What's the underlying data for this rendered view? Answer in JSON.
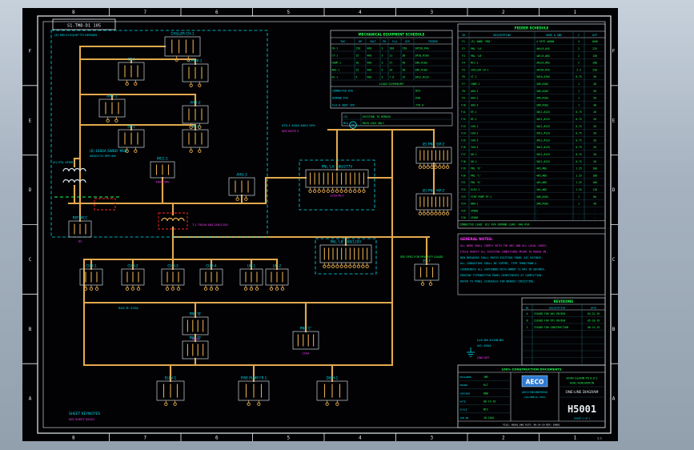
{
  "window": {
    "title_box": "S1-TM8-D1 105"
  },
  "frame": {
    "zone_cols": [
      "8",
      "7",
      "6",
      "5",
      "4",
      "3",
      "2",
      "1"
    ],
    "zone_rows": [
      "F",
      "E",
      "D",
      "C",
      "B",
      "A"
    ],
    "stamp": "1:1"
  },
  "colors": {
    "bus": "#e2a94f",
    "label": "#00dcf0",
    "magenta": "#ff3dff",
    "green": "#23ff55",
    "red": "#ff2424",
    "white": "#e9eef2",
    "logo": "#2e79cf",
    "grid": "#c9d5dc",
    "dimline": "#2a4f56"
  },
  "components": [
    {
      "id": "chiller-ch1",
      "label": "CHILLER CH-1",
      "sub": ""
    },
    {
      "id": "ct1",
      "label": "CT-1",
      "sub": ""
    },
    {
      "id": "chwp1",
      "label": "CHWP-1",
      "sub": ""
    },
    {
      "id": "ahu1",
      "label": "AHU-1",
      "sub": ""
    },
    {
      "id": "ahu2",
      "label": "AHU-2",
      "sub": ""
    },
    {
      "id": "ef1",
      "label": "EF-1",
      "sub": ""
    },
    {
      "id": "rf1",
      "label": "RF-1",
      "sub": ""
    },
    {
      "id": "mcc1",
      "label": "MCC-1",
      "sub": "480V 3PH"
    },
    {
      "id": "ahu3",
      "label": "AHU-3",
      "sub": ""
    },
    {
      "id": "ref-mcc",
      "label": "REF MCC",
      "sub": "(E)"
    },
    {
      "id": "pnl-la",
      "label": "PNL 'LA' 480/277V",
      "sub": "225A MLO"
    },
    {
      "id": "pnl-lb",
      "label": "PNL 'LB' 208/120V",
      "sub": ""
    },
    {
      "id": "dp1",
      "label": "(E) PNL 'DP-1'",
      "sub": ""
    },
    {
      "id": "hp1",
      "label": "(E) PNL 'HP-1'",
      "sub": ""
    },
    {
      "id": "cuh1",
      "label": "CUH-1",
      "sub": ""
    },
    {
      "id": "cuh2",
      "label": "CUH-2",
      "sub": ""
    },
    {
      "id": "cuh3",
      "label": "CUH-3",
      "sub": ""
    },
    {
      "id": "cuh4",
      "label": "CUH-4",
      "sub": ""
    },
    {
      "id": "uh1",
      "label": "UH-1",
      "sub": ""
    },
    {
      "id": "uh2",
      "label": "UH-2",
      "sub": ""
    },
    {
      "id": "ef7",
      "label": "EF-7",
      "sub": ""
    },
    {
      "id": "pnl-b",
      "label": "PNL 'B'",
      "sub": "100A"
    },
    {
      "id": "pnl-c",
      "label": "PNL 'C'",
      "sub": "100A"
    },
    {
      "id": "pnl-d",
      "label": "PNL 'D'",
      "sub": ""
    },
    {
      "id": "elev1",
      "label": "ELEV-1",
      "sub": ""
    },
    {
      "id": "fp1",
      "label": "FIRE PUMP FP-1",
      "sub": ""
    },
    {
      "id": "dwh1",
      "label": "DWH-1",
      "sub": ""
    }
  ],
  "texts": [
    "(E) MECH EQUIP TO REMAIN",
    "(E) 1600A SWBD 'MSB'",
    "480/277V 3PH 4W",
    "ATS-1 400A 480V 3PH",
    "SEE NOTE 5",
    "SEE SPEC FOR PRIORITY LOADS",
    "LUG BK 40-BB-BD",
    "AIC: 65KA",
    "GND DET",
    "SHEET KEYNOTES",
    "SEE SHEET E0001",
    "BUS 'B' 225A",
    "T-1 75KVA 480-208/120V",
    "M",
    "(E) UTIL XFMR"
  ],
  "equipment_schedule": {
    "title": "MECHANICAL EQUIPMENT SCHEDULE",
    "headers": [
      "TAG",
      "HP",
      "VOLT",
      "PH",
      "FLA",
      "OCP",
      "FEEDER"
    ],
    "rows": [
      [
        "CH-1",
        "150",
        "460",
        "3",
        "180",
        "250",
        "3#250,#4G"
      ],
      [
        "CT-1",
        "15",
        "460",
        "3",
        "21",
        "30",
        "3#10,#10G"
      ],
      [
        "CHWP-1",
        "20",
        "460",
        "3",
        "27",
        "40",
        "3#8,#10G"
      ],
      [
        "AHU-1",
        "25",
        "460",
        "3",
        "34",
        "50",
        "3#6,#10G"
      ],
      [
        "EF-1",
        "5",
        "460",
        "3",
        "7.6",
        "15",
        "3#12,#12G"
      ]
    ],
    "summary_title": "LOAD SUMMARY",
    "summary": [
      [
        "CONNECTED KVA",
        "825"
      ],
      [
        "DEMAND KVA",
        "640"
      ],
      [
        "FLA @ 480V 3PH",
        "770 A"
      ]
    ]
  },
  "abbreviations": [
    [
      "(E)",
      "EXISTING TO REMAIN"
    ],
    [
      "MLO",
      "MAIN LUGS ONLY"
    ]
  ],
  "feeder_schedule": {
    "title": "FEEDER SCHEDULE",
    "headers": [
      "ID",
      "DESCRIPTION",
      "WIRE & GND",
      "C",
      "OCP"
    ],
    "rows": [
      [
        "F1",
        "(E) SWBD 'MSB'",
        "4 SETS 4#600",
        "4",
        "1600"
      ],
      [
        "F2",
        "PNL 'LA'",
        "4#4/0,#4G",
        "2",
        "225"
      ],
      [
        "F3",
        "PNL 'LB'",
        "4#1/0,#6G",
        "2",
        "150"
      ],
      [
        "F4",
        "MCC-1",
        "3#3/0,#6G",
        "2",
        "200"
      ],
      [
        "F5",
        "CHILLER CH-1",
        "3#250,#4G",
        "2.5",
        "250"
      ],
      [
        "F6",
        "CT-1",
        "3#10,#10G",
        "0.75",
        "30"
      ],
      [
        "F7",
        "CHWP-1",
        "3#8,#10G",
        "1",
        "40"
      ],
      [
        "F8",
        "AHU-1",
        "3#6,#10G",
        "1",
        "50"
      ],
      [
        "F9",
        "AHU-2",
        "3#6,#10G",
        "1",
        "50"
      ],
      [
        "F10",
        "AHU-3",
        "3#8,#10G",
        "1",
        "40"
      ],
      [
        "F11",
        "EF-1",
        "3#12,#12G",
        "0.75",
        "20"
      ],
      [
        "F12",
        "RF-1",
        "3#12,#12G",
        "0.75",
        "20"
      ],
      [
        "F13",
        "CUH-1",
        "3#12,#12G",
        "0.75",
        "20"
      ],
      [
        "F14",
        "CUH-2",
        "3#12,#12G",
        "0.75",
        "20"
      ],
      [
        "F15",
        "CUH-3",
        "3#12,#12G",
        "0.75",
        "20"
      ],
      [
        "F16",
        "CUH-4",
        "3#12,#12G",
        "0.75",
        "20"
      ],
      [
        "F17",
        "UH-1",
        "3#12,#12G",
        "0.75",
        "20"
      ],
      [
        "F18",
        "UH-2",
        "3#12,#12G",
        "0.75",
        "20"
      ],
      [
        "F19",
        "PNL 'B'",
        "4#3,#8G",
        "1.25",
        "100"
      ],
      [
        "F20",
        "PNL 'C'",
        "4#3,#8G",
        "1.25",
        "100"
      ],
      [
        "F21",
        "PNL 'D'",
        "4#3,#8G",
        "1.25",
        "100"
      ],
      [
        "F22",
        "ELEV-1",
        "3#4,#8G",
        "1.25",
        "110"
      ],
      [
        "F23",
        "FIRE PUMP FP-1",
        "3#6,#10G",
        "1",
        "60"
      ],
      [
        "F24",
        "DWH-1",
        "3#8,#10G",
        "1",
        "40"
      ],
      [
        "F25",
        "SPARE",
        "-",
        "-",
        "-"
      ],
      [
        "F26",
        "SPARE",
        "-",
        "-",
        "-"
      ]
    ],
    "total": "CONNECTED LOAD: 812 KVA    DEMAND LOAD: 640 KVA"
  },
  "notes": {
    "title": "GENERAL NOTES:",
    "lines": [
      "ALL WORK SHALL COMPLY WITH THE NEC AND ALL LOCAL CODES.",
      "FIELD VERIFY ALL EXISTING CONDITIONS PRIOR TO ROUGH-IN.",
      "NEW BREAKERS SHALL MATCH EXISTING PANEL AIC RATINGS.",
      "ALL CONDUCTORS SHALL BE COPPER, TYPE THHN/THWN-2.",
      "COORDINATE ALL SHUTDOWNS WITH OWNER 72 HRS IN ADVANCE.",
      "PROVIDE TYPEWRITTEN PANEL DIRECTORIES AT COMPLETION.",
      "REFER TO PANEL SCHEDULES FOR BRANCH CIRCUITING."
    ]
  },
  "revisions": {
    "title": "REVISIONS",
    "headers": [
      "NO",
      "DESCRIPTION",
      "DATE"
    ],
    "rows": [
      [
        "A",
        "ISSUED FOR 50% REVIEW",
        "03-22-19"
      ],
      [
        "B",
        "ISSUED FOR 95% REVIEW",
        "05-10-19"
      ],
      [
        "1",
        "ISSUED FOR CONSTRUCTION",
        "06-14-19"
      ],
      [
        "",
        "",
        ""
      ],
      [
        "",
        "",
        ""
      ],
      [
        "",
        "",
        ""
      ],
      [
        "",
        "",
        ""
      ],
      [
        "",
        "",
        ""
      ]
    ]
  },
  "titleblock": {
    "phase": "100% CONSTRUCTION DOCUMENTS",
    "fields": [
      [
        "DESIGNED",
        "JMS"
      ],
      [
        "DRAWN",
        "KLT"
      ],
      [
        "CHECKED",
        "RWD"
      ],
      [
        "DATE",
        "06-14-19"
      ],
      [
        "SCALE",
        "NTS"
      ],
      [
        "JOB NO",
        "18-1042"
      ]
    ],
    "logo": "AECO",
    "firm1": "AECO ENGINEERING",
    "firm2": "COLUMBUS, OHIO",
    "project1": "JOHN GLENN PS 9-0-1",
    "project2": "HVAC RENOVATION",
    "sheet_title": "ONE-LINE DIAGRAM",
    "drawing_no": "H5001",
    "sheet_of": "SHEET 1 OF 1",
    "footer": "FILE: H5001.DWG   PLOT: 06-14-19   REF: E0001"
  }
}
